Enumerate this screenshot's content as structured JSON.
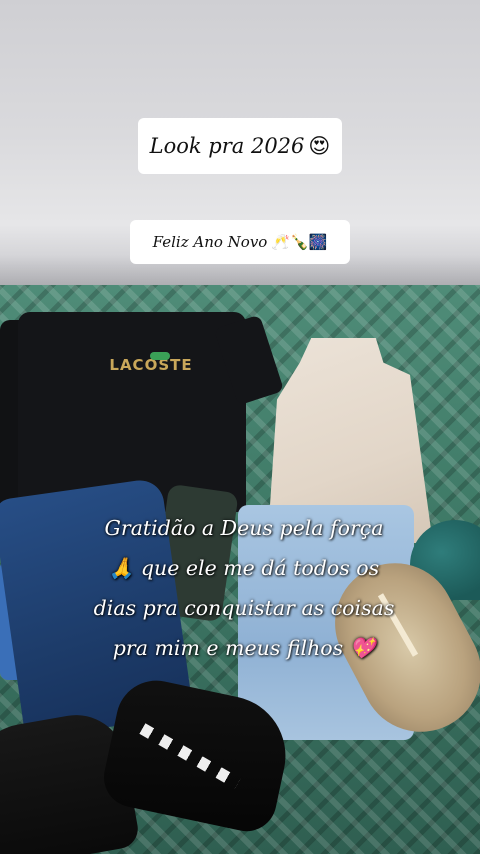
{
  "stickers": {
    "title": {
      "text": "Look pra 2026",
      "emoji": "😍"
    },
    "subtitle": {
      "text": "Feliz Ano Novo",
      "emoji": "🥂🍾🎆"
    }
  },
  "shirt_logo": "LACOSTE",
  "caption": {
    "lines": [
      "Gratidão a Deus pela força",
      "🙏 que ele me dá todos os",
      "dias pra conquistar as coisas",
      "pra mim e meus filhos 💖"
    ]
  },
  "colors": {
    "floor_green": "#3f7a67",
    "wall": "#dadadd",
    "sticker_bg": "#ffffff",
    "caption_text": "#ffffff"
  }
}
